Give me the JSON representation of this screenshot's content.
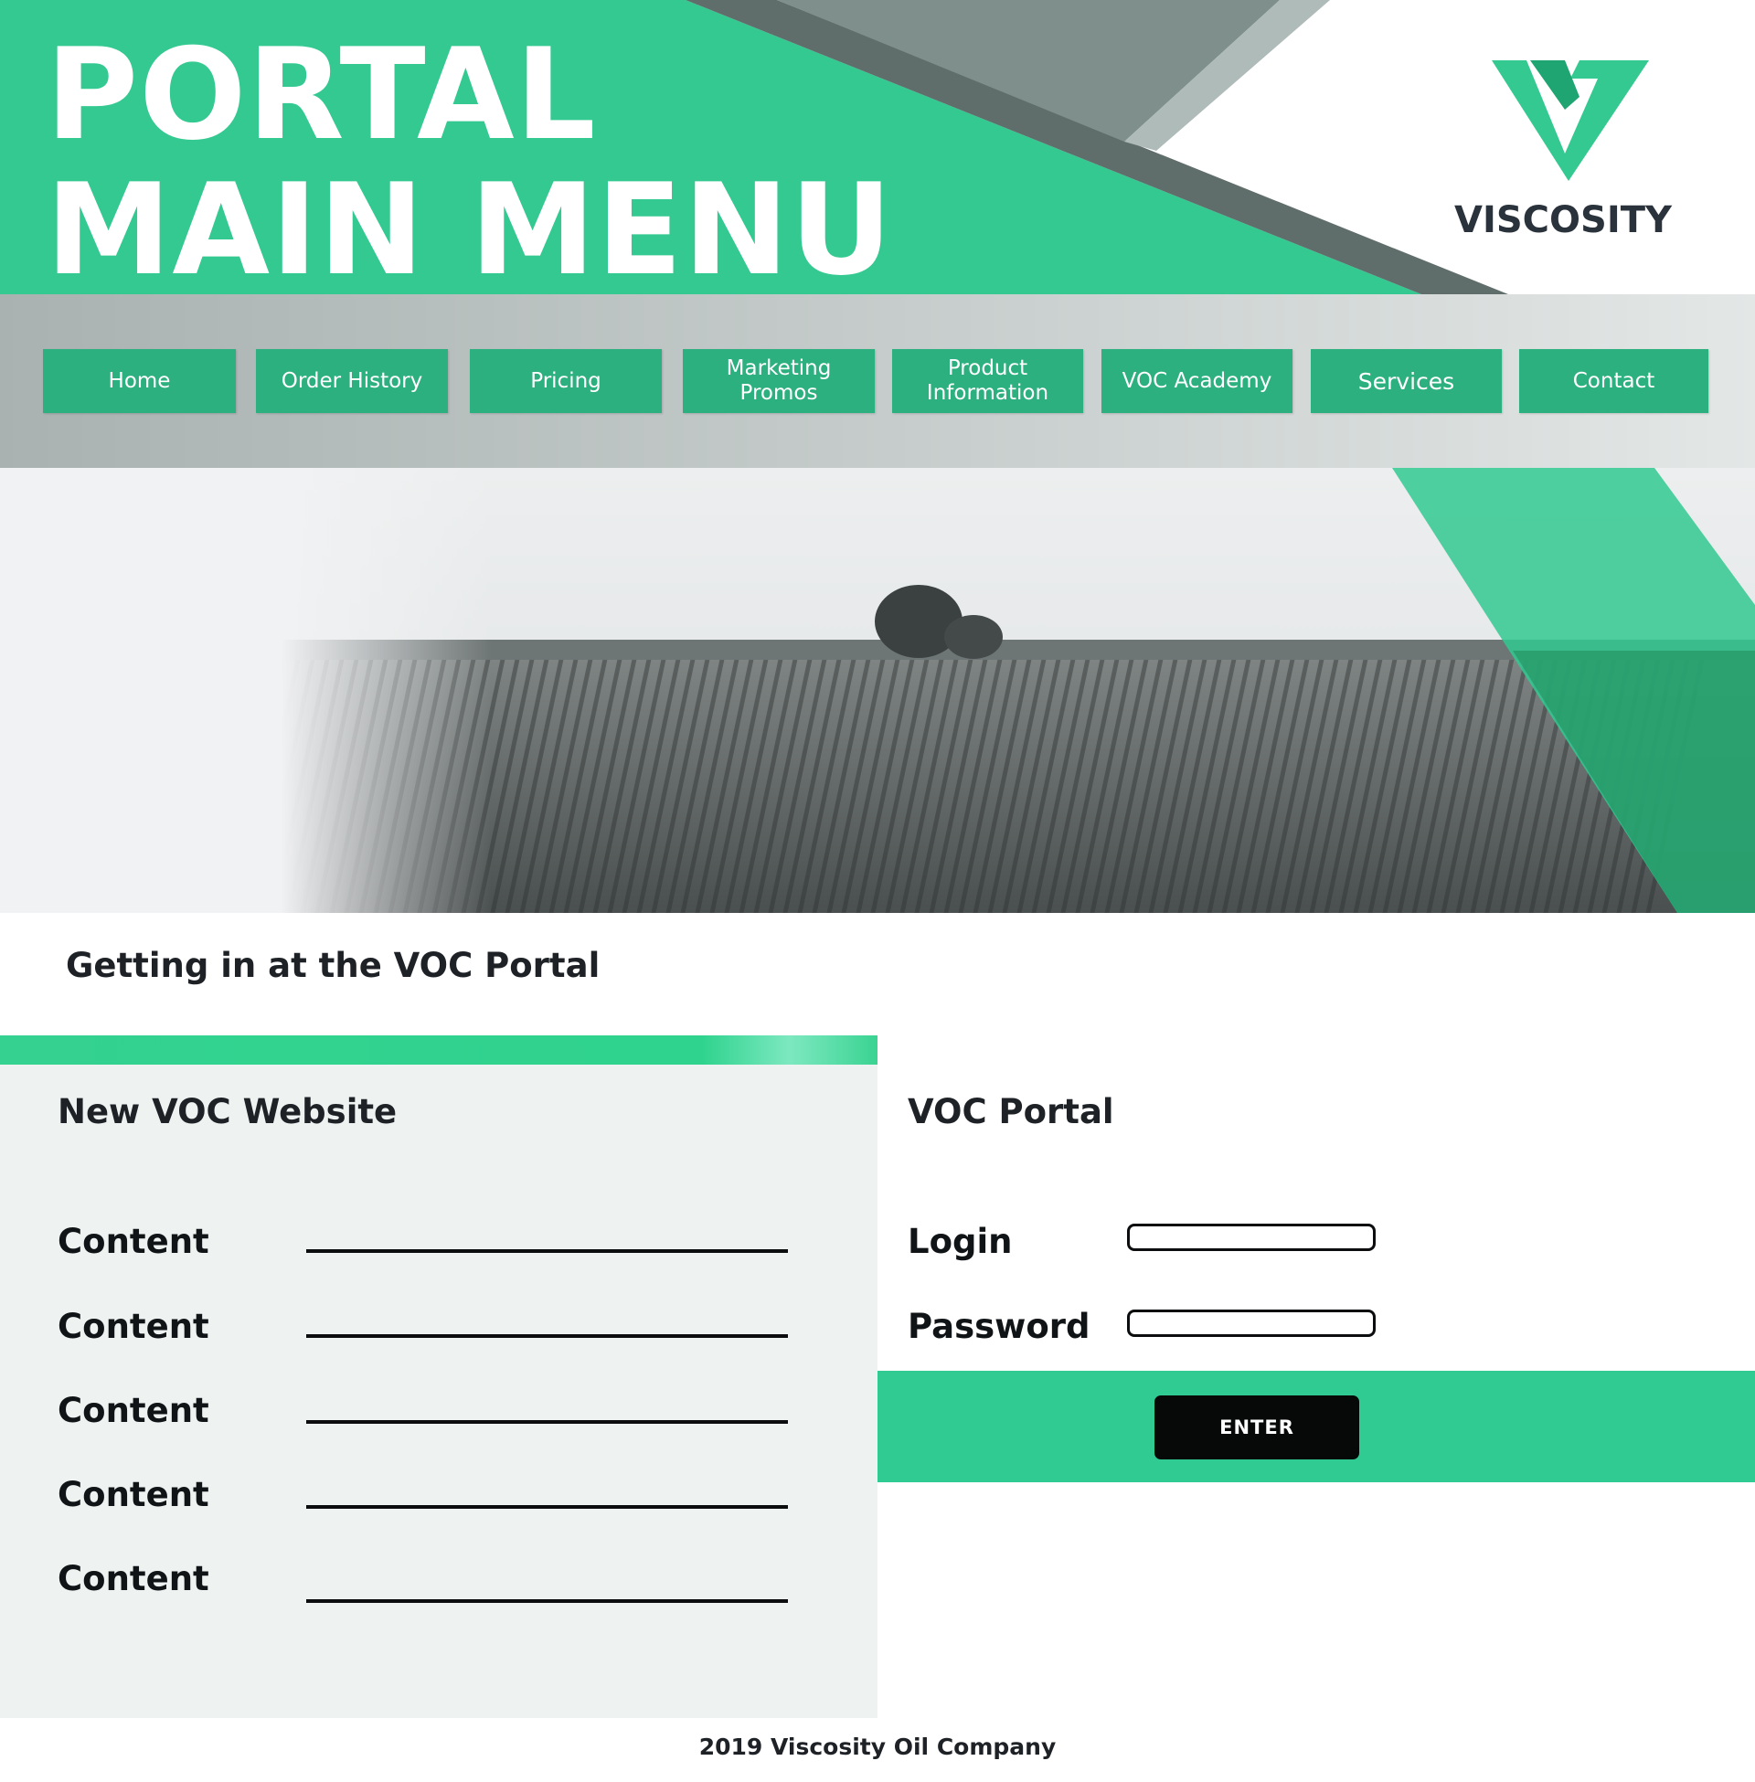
{
  "header": {
    "title_line1": "PORTAL",
    "title_line2": "MAIN MENU",
    "logo_name": "VISCOSITY"
  },
  "nav": {
    "items": [
      {
        "label": "Home"
      },
      {
        "label": "Order History"
      },
      {
        "label": "Pricing"
      },
      {
        "label": "Marketing\nPromos"
      },
      {
        "label": "Product\nInformation"
      },
      {
        "label": "VOC Academy"
      },
      {
        "label": "Services"
      },
      {
        "label": "Contact"
      }
    ]
  },
  "hero": {
    "image": "farm field landscape photo (grayscale with green overlay)"
  },
  "section": {
    "title": "Getting in at the VOC Portal"
  },
  "website_panel": {
    "title": "New VOC Website",
    "rows": [
      {
        "label": "Content"
      },
      {
        "label": "Content"
      },
      {
        "label": "Content"
      },
      {
        "label": "Content"
      },
      {
        "label": "Content"
      }
    ]
  },
  "portal_panel": {
    "title": "VOC Portal",
    "login_label": "Login",
    "login_value": "",
    "password_label": "Password",
    "password_value": "",
    "enter_label": "ENTER"
  },
  "footer": {
    "text": "2019 Viscosity Oil Company"
  },
  "colors": {
    "brand_green": "#33c991",
    "button_green": "#2db07f",
    "dark_gray": "#5f6d6b",
    "text_dark": "#1e2226",
    "panel_bg": "#eef2f1"
  }
}
